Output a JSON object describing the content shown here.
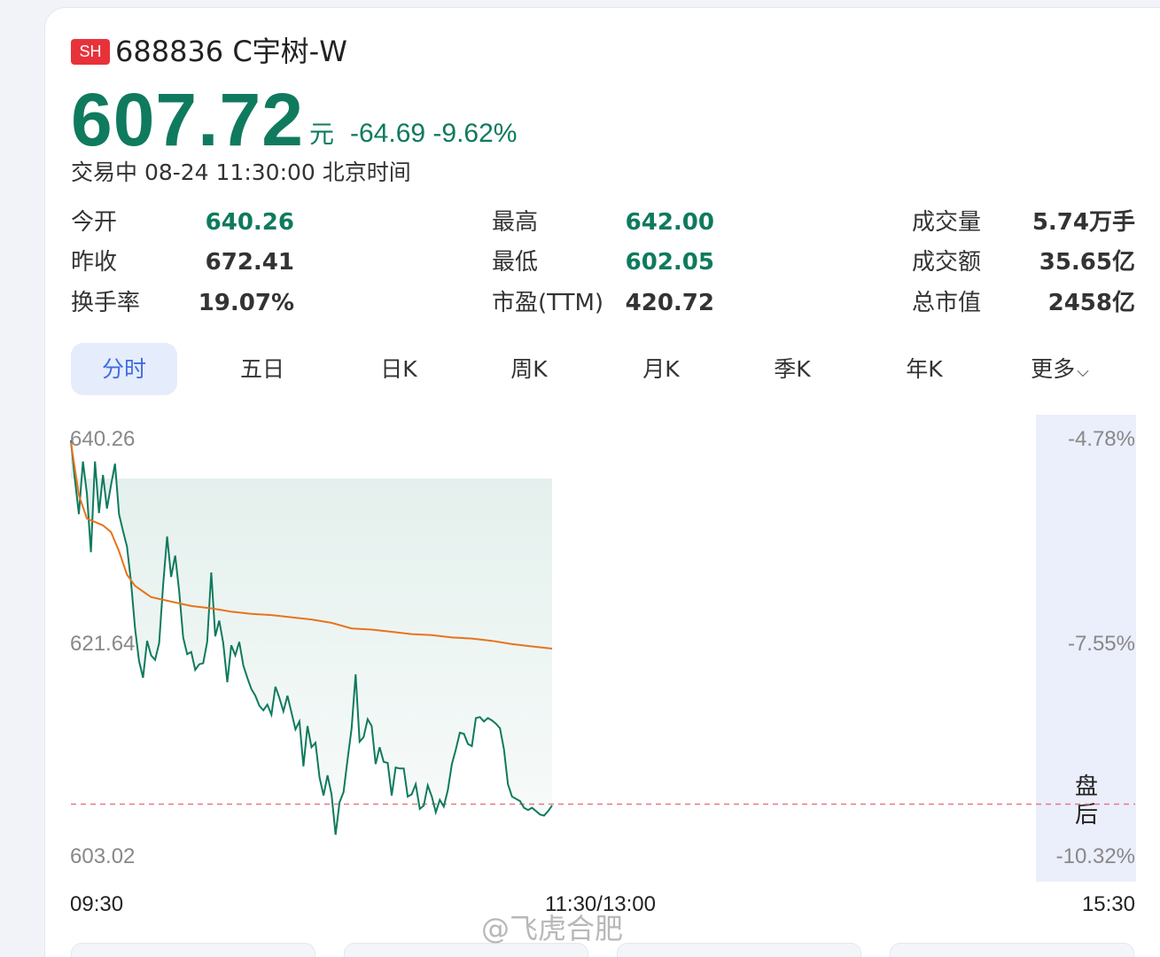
{
  "header": {
    "exchange_badge": "SH",
    "code_name": "688836 C宇树-W",
    "price": "607.72",
    "unit": "元",
    "change": "-64.69",
    "change_pct": "-9.62%",
    "status": "交易中 08-24 11:30:00 北京时间"
  },
  "stats": [
    {
      "label": "今开",
      "value": "640.26",
      "color": "green"
    },
    {
      "label": "最高",
      "value": "642.00",
      "color": "green"
    },
    {
      "label": "成交量",
      "value": "5.74万手",
      "color": "normal"
    },
    {
      "label": "昨收",
      "value": "672.41",
      "color": "normal"
    },
    {
      "label": "最低",
      "value": "602.05",
      "color": "green"
    },
    {
      "label": "成交额",
      "value": "35.65亿",
      "color": "normal"
    },
    {
      "label": "换手率",
      "value": "19.07%",
      "color": "normal"
    },
    {
      "label": "市盈(TTM)",
      "value": "420.72",
      "color": "normal"
    },
    {
      "label": "总市值",
      "value": "2458亿",
      "color": "normal"
    }
  ],
  "tabs": [
    "分时",
    "五日",
    "日K",
    "周K",
    "月K",
    "季K",
    "年K",
    "更多"
  ],
  "active_tab": "分时",
  "after_hours_label": "盘后",
  "watermark": "@飞虎合肥",
  "colors": {
    "price_down": "#0f7a5e",
    "badge": "#e8323a",
    "avg_line": "#e8731c",
    "active_tab_bg": "#e5ecfb",
    "active_tab_text": "#3f6ee0",
    "prev_close_line": "#e57a85"
  },
  "chart_data": {
    "type": "line",
    "title": "",
    "x_ticks": [
      "09:30",
      "11:30/13:00",
      "15:30"
    ],
    "y_ticks_left": [
      "640.26",
      "621.64",
      "603.02"
    ],
    "y_ticks_right": [
      "-4.78%",
      "-7.55%",
      "-10.32%"
    ],
    "ylim": [
      603.02,
      640.26
    ],
    "prev_close_ref": 607.72,
    "grid": false,
    "series": [
      {
        "style": "price_line_with_area",
        "x_minutes": [
          0,
          1,
          2,
          3,
          4,
          5,
          6,
          7,
          8,
          9,
          10,
          11,
          12,
          13,
          14,
          15,
          16,
          17,
          18,
          19,
          20,
          21,
          22,
          23,
          24,
          25,
          26,
          27,
          28,
          29,
          30,
          31,
          32,
          33,
          34,
          35,
          36,
          37,
          38,
          39,
          40,
          41,
          42,
          43,
          44,
          45,
          46,
          47,
          48,
          49,
          50,
          51,
          52,
          53,
          54,
          55,
          56,
          57,
          58,
          59,
          60,
          61,
          62,
          63,
          64,
          65,
          66,
          67,
          68,
          69,
          70,
          71,
          72,
          73,
          74,
          75,
          76,
          77,
          78,
          79,
          80,
          81,
          82,
          83,
          84,
          85,
          86,
          87,
          88,
          89,
          90,
          91,
          92,
          93,
          94,
          95,
          96,
          97,
          98,
          99,
          100,
          101,
          102,
          103,
          104,
          105,
          106,
          107,
          108,
          109,
          110,
          111,
          112,
          113,
          114,
          115,
          116,
          117,
          118,
          119,
          120
        ],
        "values": [
          640.2,
          636.7,
          633.6,
          638.3,
          635.4,
          630.2,
          638.3,
          633.7,
          637.1,
          634.1,
          636.2,
          638.1,
          633.6,
          632.1,
          630.7,
          627.5,
          623.4,
          620.5,
          619.0,
          622.3,
          621.0,
          620.6,
          622.1,
          627.3,
          631.6,
          628.0,
          629.9,
          626.7,
          622.6,
          621.1,
          621.3,
          619.7,
          620.2,
          620.3,
          622.2,
          628.4,
          622.7,
          624.1,
          622.1,
          618.6,
          621.9,
          621.0,
          622.2,
          620.1,
          619.0,
          618.0,
          617.4,
          616.5,
          616.1,
          616.6,
          615.7,
          618.2,
          617.2,
          616.0,
          617.4,
          615.9,
          614.4,
          615.1,
          611.1,
          614.7,
          612.8,
          613.2,
          610.1,
          608.5,
          610.3,
          608.6,
          605.0,
          607.9,
          608.8,
          611.7,
          614.5,
          619.3,
          613.3,
          613.7,
          615.3,
          614.7,
          611.3,
          612.8,
          611.5,
          611.4,
          608.5,
          611.0,
          610.9,
          610.9,
          608.4,
          608.6,
          609.5,
          607.3,
          607.6,
          609.4,
          608.4,
          607.0,
          608.1,
          607.5,
          609.0,
          611.3,
          612.6,
          614.1,
          614.0,
          613.1,
          612.9,
          615.4,
          615.5,
          615.1,
          615.4,
          615.2,
          614.9,
          614.5,
          612.6,
          609.5,
          608.4,
          608.2,
          608.0,
          607.4,
          607.2,
          607.4,
          607.1,
          606.8,
          606.7,
          607.1,
          607.6
        ]
      },
      {
        "style": "average_line",
        "x_minutes": [
          0,
          2,
          4,
          6,
          8,
          10,
          12,
          14,
          16,
          18,
          20,
          25,
          30,
          35,
          40,
          45,
          50,
          55,
          60,
          65,
          70,
          75,
          80,
          85,
          90,
          95,
          100,
          105,
          110,
          115,
          120
        ],
        "values": [
          640.0,
          635.3,
          633.2,
          632.9,
          632.6,
          632.0,
          630.3,
          628.2,
          627.2,
          626.7,
          626.2,
          625.8,
          625.4,
          625.2,
          624.9,
          624.7,
          624.6,
          624.4,
          624.2,
          623.9,
          623.4,
          623.3,
          623.1,
          622.9,
          622.8,
          622.6,
          622.5,
          622.3,
          622.0,
          621.8,
          621.6
        ]
      }
    ]
  }
}
